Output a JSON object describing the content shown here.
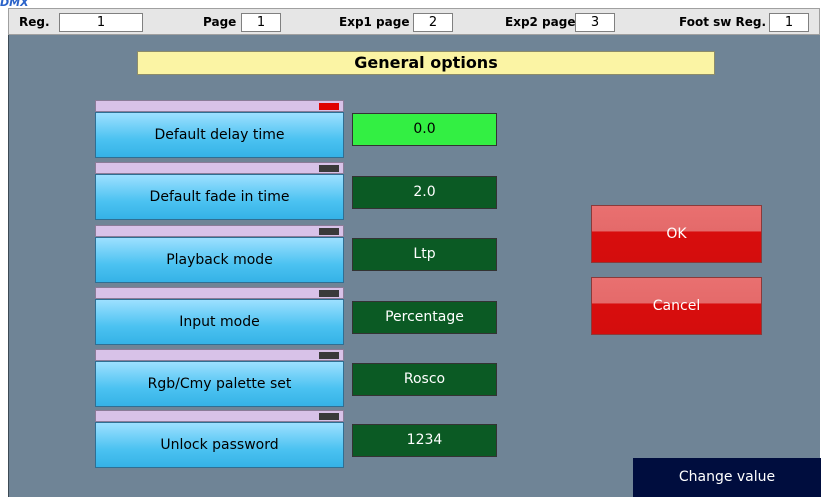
{
  "topbar": {
    "reg": {
      "label": "Reg.",
      "value": "1"
    },
    "page": {
      "label": "Page",
      "value": "1"
    },
    "exp1": {
      "label": "Exp1 page",
      "value": "2"
    },
    "exp2": {
      "label": "Exp2 page",
      "value": "3"
    },
    "foot": {
      "label": "Foot sw Reg.",
      "value": "1"
    }
  },
  "title": "General options",
  "options": [
    {
      "label": "Default delay time",
      "value": "0.0",
      "led": "red",
      "active": true
    },
    {
      "label": "Default fade in time",
      "value": "2.0",
      "led": "dark",
      "active": false
    },
    {
      "label": "Playback mode",
      "value": "Ltp",
      "led": "dark",
      "active": false
    },
    {
      "label": "Input mode",
      "value": "Percentage",
      "led": "dark",
      "active": false
    },
    {
      "label": "Rgb/Cmy palette set",
      "value": "Rosco",
      "led": "dark",
      "active": false
    },
    {
      "label": "Unlock password",
      "value": "1234",
      "led": "dark",
      "active": false
    }
  ],
  "buttons": {
    "ok": "OK",
    "cancel": "Cancel"
  },
  "status": "Change value",
  "colors": {
    "background": "#6f8496",
    "title_bg": "#fbf4a4",
    "option_button": "#4bc2f1",
    "value_dark": "#0b5a24",
    "value_active": "#33ef43",
    "led_active": "#e00000",
    "action_button": "#d80d0d",
    "status_bg": "#000d3e"
  }
}
